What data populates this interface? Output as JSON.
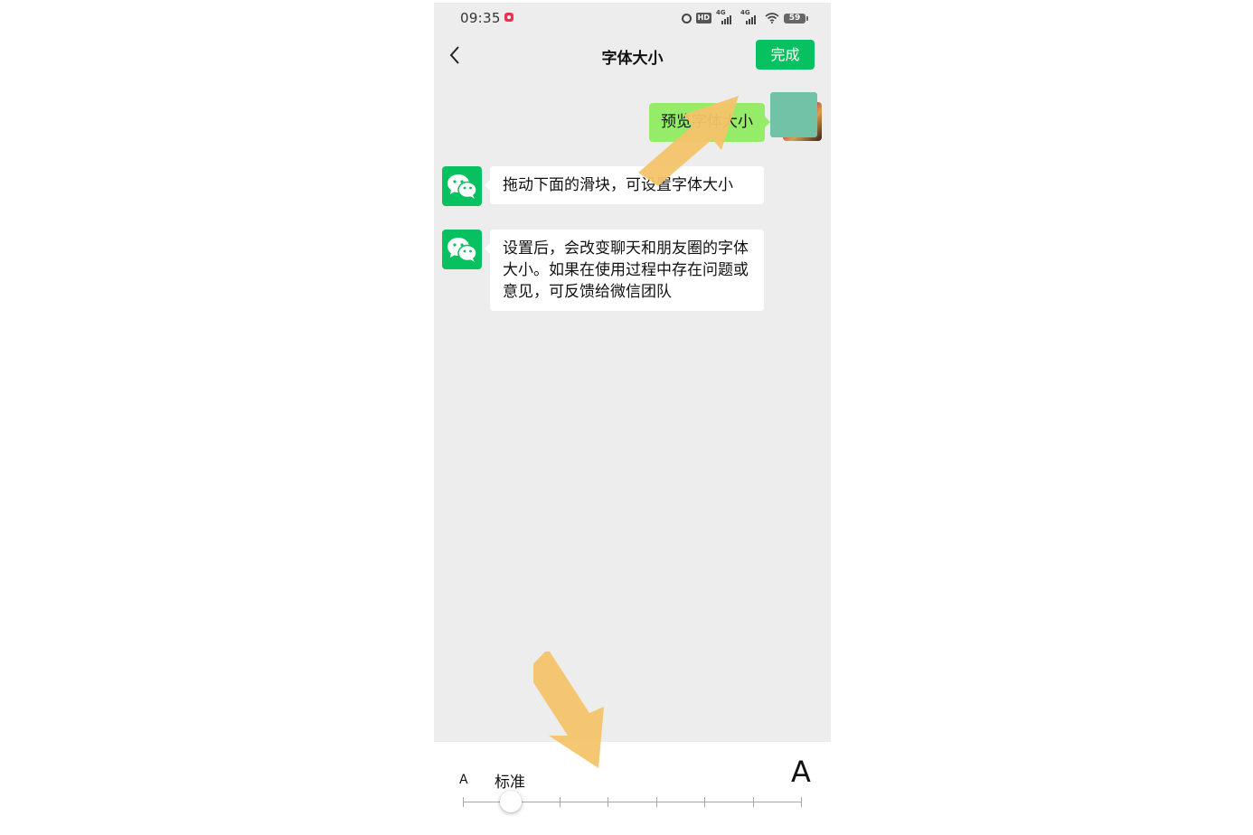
{
  "status_bar": {
    "time": "09:35",
    "hd_label": "HD",
    "network_1": "4G",
    "network_2": "4G",
    "battery": "59"
  },
  "nav": {
    "title": "字体大小",
    "done_label": "完成",
    "back_icon": "chevron-left-icon"
  },
  "chat": {
    "preview_message": "预览字体大小",
    "messages": [
      {
        "text": "拖动下面的滑块，可设置字体大小"
      },
      {
        "text": "设置后，会改变聊天和朋友圈的字体大小。如果在使用过程中存在问题或意见，可反馈给微信团队"
      }
    ]
  },
  "font_slider": {
    "small_label": "A",
    "current_label": "标准",
    "large_label": "A",
    "steps": 8,
    "selected_index": 1
  },
  "colors": {
    "wechat_green": "#07c160",
    "bubble_green": "#95ec69",
    "chat_background": "#ededed",
    "annotation_arrow": "#f5c46a"
  }
}
